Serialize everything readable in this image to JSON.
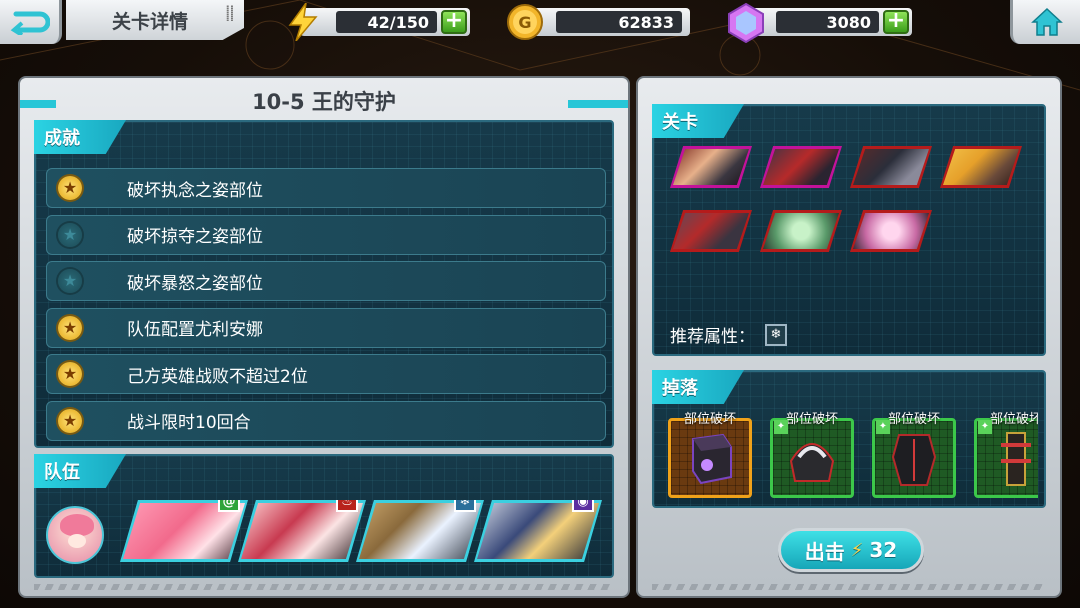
{
  "header": {
    "page_title": "关卡详情",
    "energy": "42/150",
    "gold": "62833",
    "gems": "3080",
    "plus_label": "+",
    "gold_icon_letter": "G"
  },
  "stage": {
    "title": "10-5  王的守护"
  },
  "achievements": {
    "label": "成就",
    "items": [
      {
        "text": "破坏执念之姿部位",
        "completed": true
      },
      {
        "text": "破坏掠夺之姿部位",
        "completed": false
      },
      {
        "text": "破坏暴怒之姿部位",
        "completed": false
      },
      {
        "text": "队伍配置尤利安娜",
        "completed": true
      },
      {
        "text": "己方英雄战败不超过2位",
        "completed": true
      },
      {
        "text": "战斗限时10回合",
        "completed": true
      }
    ]
  },
  "team": {
    "label": "队伍",
    "heroes": [
      {
        "element": "wind",
        "element_color": "#2ea43a",
        "element_glyph": "@"
      },
      {
        "element": "fire",
        "element_color": "#b8231c",
        "element_glyph": "♨"
      },
      {
        "element": "ice",
        "element_color": "#2b6f9a",
        "element_glyph": "❄"
      },
      {
        "element": "dark",
        "element_color": "#5b2ea0",
        "element_glyph": "◉"
      }
    ]
  },
  "stage_panel": {
    "label": "关卡",
    "recommend_label": "推荐属性：",
    "recommend_attr_glyph": "❄",
    "enemies": [
      {
        "frame_color": "#c3129a"
      },
      {
        "frame_color": "#c3129a"
      },
      {
        "frame_color": "#b51b1b"
      },
      {
        "frame_color": "#b51b1b"
      },
      {
        "frame_color": "#b51b1b"
      },
      {
        "frame_color": "#b51b1b"
      },
      {
        "frame_color": "#b51b1b"
      }
    ]
  },
  "drops_panel": {
    "label": "掉落",
    "items": [
      {
        "label": "部位破坏",
        "rarity_color": "#f0a21a"
      },
      {
        "label": "部位破坏",
        "rarity_color": "#3cc84a"
      },
      {
        "label": "部位破坏",
        "rarity_color": "#3cc84a"
      },
      {
        "label": "部位破坏",
        "rarity_color": "#3cc84a"
      }
    ]
  },
  "attack_button": {
    "label": "出击",
    "cost": "32"
  }
}
